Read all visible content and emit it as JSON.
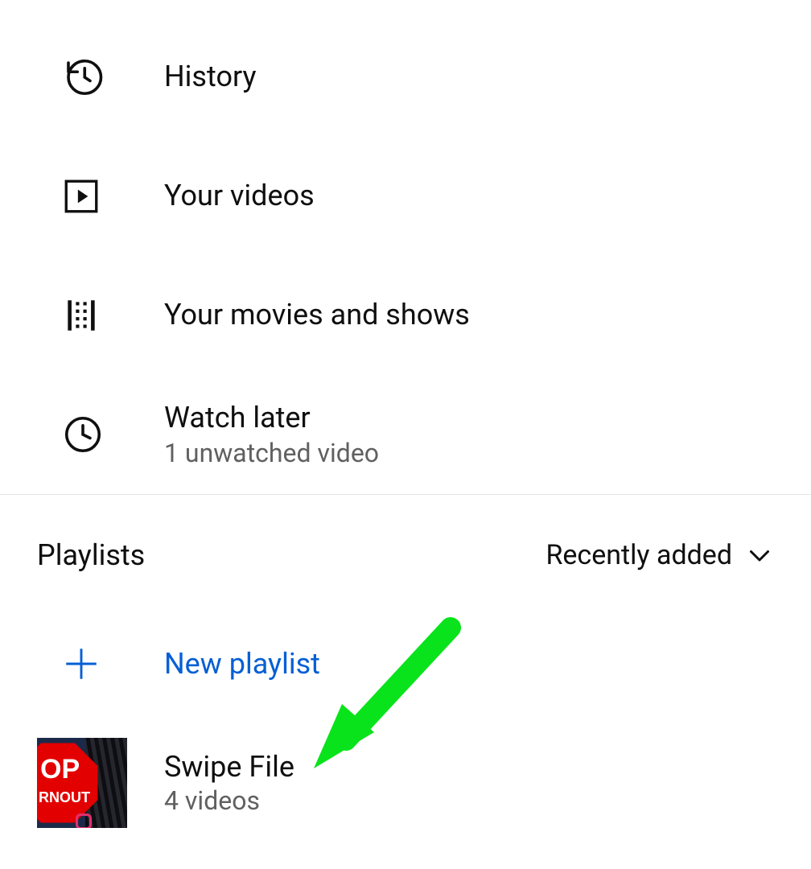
{
  "menu": [
    {
      "id": "history",
      "label": "History",
      "sub": null,
      "icon": "history-icon"
    },
    {
      "id": "your-videos",
      "label": "Your videos",
      "sub": null,
      "icon": "play-square-icon"
    },
    {
      "id": "your-movies",
      "label": "Your movies and shows",
      "sub": null,
      "icon": "film-icon"
    },
    {
      "id": "watch-later",
      "label": "Watch later",
      "sub": "1 unwatched video",
      "icon": "clock-icon"
    }
  ],
  "playlists": {
    "section_title": "Playlists",
    "sort_label": "Recently added",
    "new_playlist_label": "New playlist",
    "items": [
      {
        "title": "Swipe File",
        "sub": "4 videos",
        "thumb_text1": "OP",
        "thumb_text2": "RNOUT"
      }
    ]
  },
  "annotation": {
    "arrow_color": "#09e31b"
  }
}
